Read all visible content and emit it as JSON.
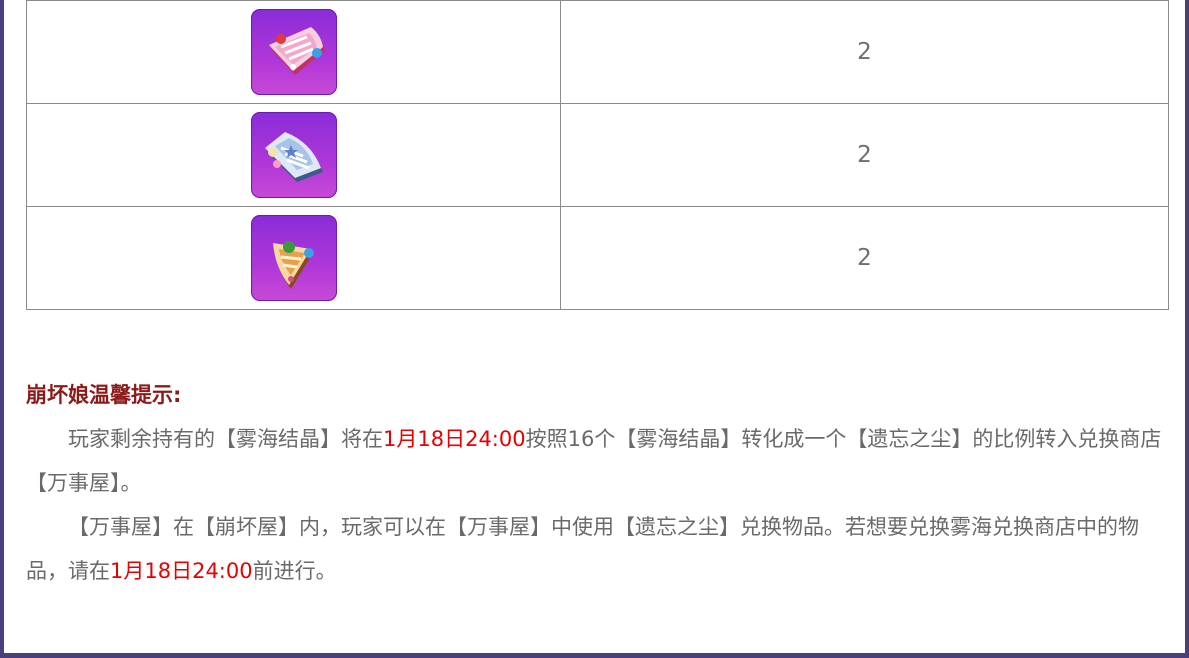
{
  "items": [
    {
      "icon": "pink-fan-fragment-icon",
      "count": "2"
    },
    {
      "icon": "blue-fan-fragment-icon",
      "count": "2"
    },
    {
      "icon": "gold-fan-fragment-icon",
      "count": "2"
    }
  ],
  "tips": {
    "title": "崩坏娘温馨提示:",
    "p1": {
      "a": "玩家剩余持有的【雾海结晶】将在",
      "date": "1月18日24:00",
      "b": "按照16个【雾海结晶】转化成一个【遗忘之尘】的比例转入兑换商店【万事屋】。"
    },
    "p2": {
      "a": "【万事屋】在【崩坏屋】内，玩家可以在【万事屋】中使用【遗忘之尘】兑换物品。若想要兑换雾海兑换商店中的物品，请在",
      "date": "1月18日24:00",
      "b": "前进行。"
    }
  },
  "colors": {
    "frame": "#4a3f7a",
    "tip_title": "#8b1a1a",
    "highlight_date": "#e60000",
    "icon_bg": "#a030d8"
  }
}
